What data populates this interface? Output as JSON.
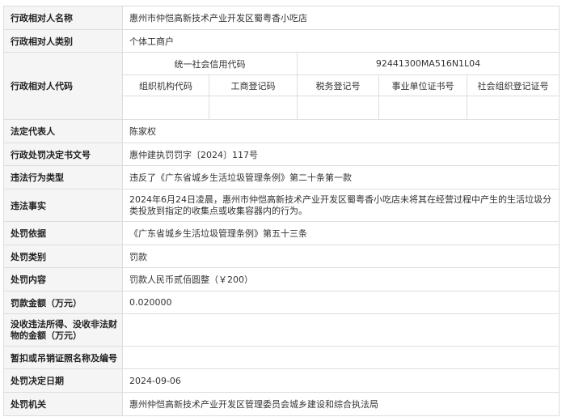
{
  "rows": {
    "name": {
      "label": "行政相对人名称",
      "value": "惠州市仲恺高新技术产业开发区蜀粤香小吃店"
    },
    "category": {
      "label": "行政相对人类别",
      "value": "个体工商户"
    },
    "codes": {
      "label": "行政相对人代码",
      "uscc_label": "统一社会信用代码",
      "uscc_value": "92441300MA516N1L04",
      "headers": [
        "组织机构代码",
        "工商登记码",
        "税务登记号",
        "事业单位证书号",
        "社会组织登记证号"
      ],
      "values": [
        "",
        "",
        "",
        "",
        ""
      ]
    },
    "legal_rep": {
      "label": "法定代表人",
      "value": "陈家权"
    },
    "doc_no": {
      "label": "行政处罚决定书文号",
      "value": "惠仲建执罚罚字〔2024〕117号"
    },
    "violation_type": {
      "label": "违法行为类型",
      "value": "违反了《广东省城乡生活垃圾管理条例》第二十条第一款"
    },
    "facts": {
      "label": "违法事实",
      "value": "2024年6月24日凌晨，惠州市仲恺高新技术产业开发区蜀粤香小吃店未将其在经营过程中产生的生活垃圾分类投放到指定的收集点或收集容器内的行为。"
    },
    "basis": {
      "label": "处罚依据",
      "value": "《广东省城乡生活垃圾管理条例》第五十三条"
    },
    "type": {
      "label": "处罚类别",
      "value": "罚款"
    },
    "content": {
      "label": "处罚内容",
      "value": "罚款人民币贰佰圆整（￥200）"
    },
    "amount": {
      "label": "罚款金额（万元）",
      "value": "0.020000"
    },
    "confiscation": {
      "label": "没收违法所得、没收非法财物的金额（万元）",
      "value": ""
    },
    "license": {
      "label": "暂扣或吊销证照名称及编号",
      "value": ""
    },
    "date": {
      "label": "处罚决定日期",
      "value": "2024-09-06"
    },
    "authority": {
      "label": "处罚机关",
      "value": "惠州仲恺高新技术产业开发区管理委员会城乡建设和综合执法局"
    }
  }
}
